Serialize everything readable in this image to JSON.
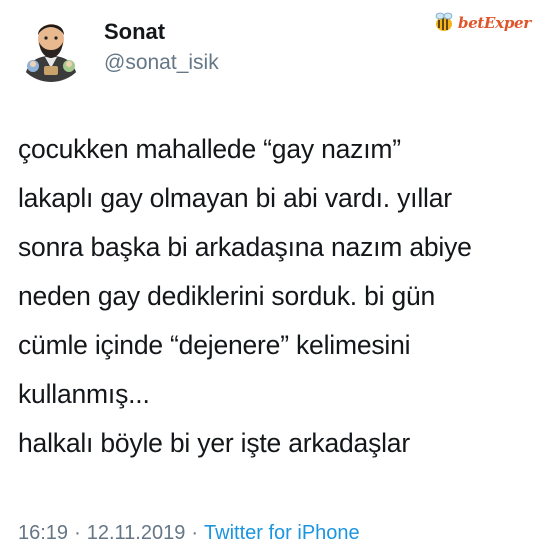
{
  "author": {
    "display_name": "Sonat",
    "handle": "@sonat_isik",
    "avatar_icon": "cartoon-avatar-icon"
  },
  "watermark": {
    "text": "betExper",
    "icon": "bee-logo-icon"
  },
  "tweet": {
    "lines": [
      "çocukken mahallede “gay nazım”",
      "lakaplı gay olmayan bi abi vardı. yıllar",
      "sonra başka bi arkadaşına nazım abiye",
      "neden gay dediklerini sorduk. bi gün",
      "cümle içinde “dejenere” kelimesini",
      "kullanmış...",
      "halkalı böyle bi yer işte arkadaşlar"
    ]
  },
  "footer": {
    "time": "16:19",
    "separator": "·",
    "date": "12.11.2019",
    "source": "Twitter for iPhone"
  },
  "colors": {
    "text": "#14171a",
    "secondary": "#657786",
    "link": "#1b95e0",
    "watermark": "#e0542a"
  }
}
